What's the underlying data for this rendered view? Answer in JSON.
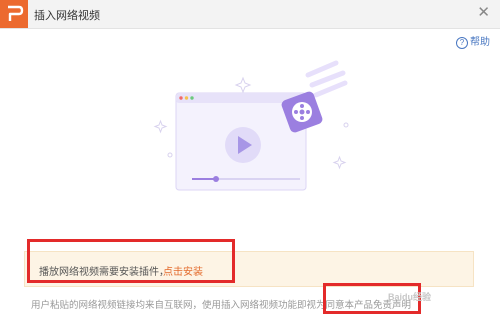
{
  "window": {
    "title": "插入网络视频"
  },
  "help": {
    "label": "帮助",
    "icon": "question-circle-icon"
  },
  "notice": {
    "message": "播放网络视频需要安装插件，",
    "link": "点击安装"
  },
  "disclaimer": "用户粘贴的网络视频链接均来自互联网，使用插入网络视频功能即视为同意本产品免责声明",
  "watermark": "Baidu经验",
  "colors": {
    "brand": "#ec6a2f",
    "accent": "#e36a2b",
    "illustration_purple": "#9b7fe0",
    "red_annotation": "#e32a2a"
  }
}
